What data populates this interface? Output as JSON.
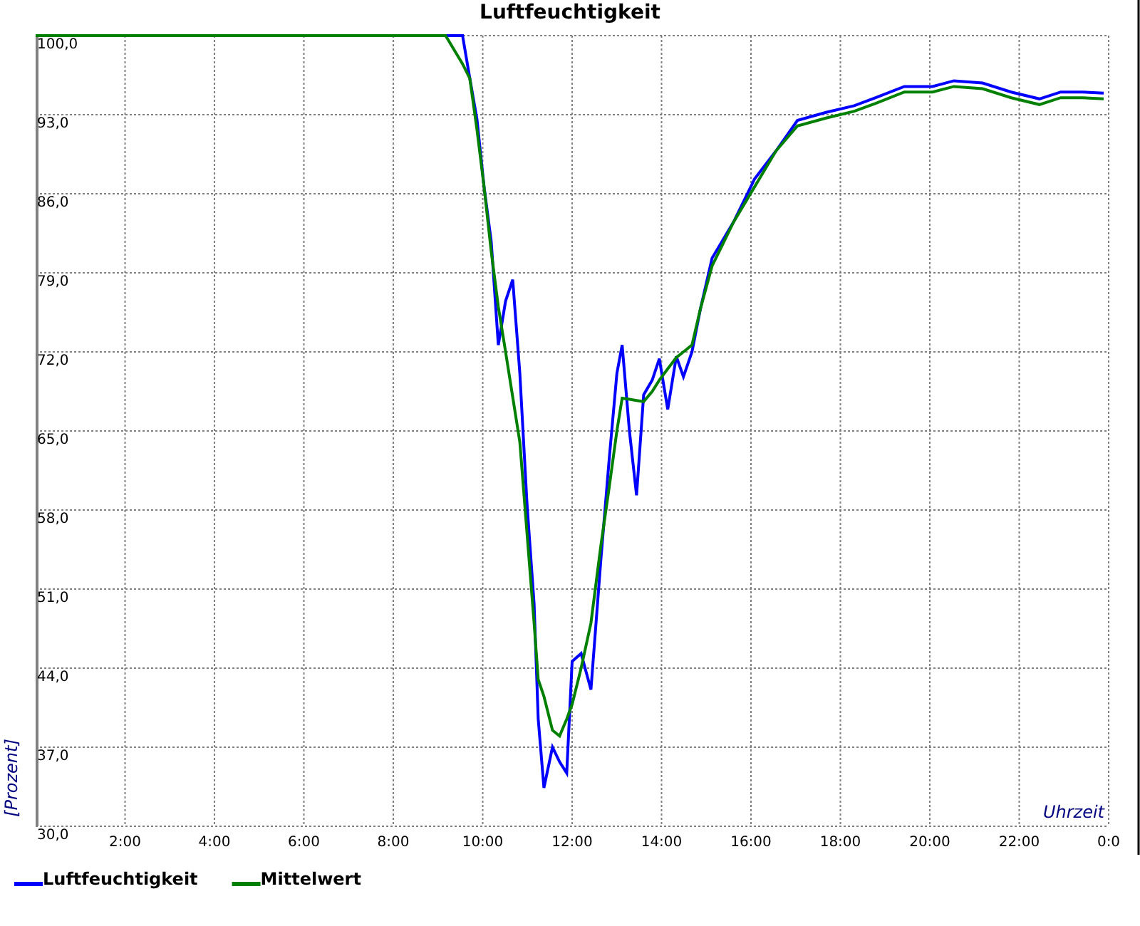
{
  "chart": {
    "chart_data": {
      "type": "line",
      "title": "Luftfeuchtigkeit",
      "xlabel": "Uhrzeit",
      "ylabel": "[Prozent]",
      "xlim": [
        0,
        24
      ],
      "ylim": [
        30,
        100
      ],
      "grid": true,
      "legend": true,
      "xticks": [
        {
          "value": 2,
          "label": "2:00"
        },
        {
          "value": 4,
          "label": "4:00"
        },
        {
          "value": 6,
          "label": "6:00"
        },
        {
          "value": 8,
          "label": "8:00"
        },
        {
          "value": 10,
          "label": "10:00"
        },
        {
          "value": 12,
          "label": "12:00"
        },
        {
          "value": 14,
          "label": "14:00"
        },
        {
          "value": 16,
          "label": "16:00"
        },
        {
          "value": 18,
          "label": "18:00"
        },
        {
          "value": 20,
          "label": "20:00"
        },
        {
          "value": 22,
          "label": "22:00"
        },
        {
          "value": 24,
          "label": "0:0"
        }
      ],
      "yticks": [
        {
          "value": 30,
          "label": "30,0"
        },
        {
          "value": 37,
          "label": "37,0"
        },
        {
          "value": 44,
          "label": "44,0"
        },
        {
          "value": 51,
          "label": "51,0"
        },
        {
          "value": 58,
          "label": "58,0"
        },
        {
          "value": 65,
          "label": "65,0"
        },
        {
          "value": 72,
          "label": "72,0"
        },
        {
          "value": 79,
          "label": "79,0"
        },
        {
          "value": 86,
          "label": "86,0"
        },
        {
          "value": 93,
          "label": "93,0"
        },
        {
          "value": 100,
          "label": "100,0"
        }
      ],
      "x": [
        0,
        9.17,
        9.55,
        9.71,
        9.87,
        10.03,
        10.19,
        10.35,
        10.51,
        10.67,
        10.83,
        10.99,
        11.15,
        11.24,
        11.37,
        11.56,
        11.72,
        11.88,
        12.0,
        12.2,
        12.42,
        12.64,
        12.83,
        13.0,
        13.12,
        13.28,
        13.44,
        13.6,
        13.79,
        13.95,
        14.14,
        14.33,
        14.49,
        14.68,
        14.87,
        15.13,
        15.61,
        16.08,
        16.56,
        17.04,
        17.68,
        18.31,
        18.79,
        19.43,
        20.06,
        20.54,
        21.18,
        21.82,
        22.45,
        22.93,
        23.41,
        23.89
      ],
      "series": [
        {
          "name": "Luftfeuchtigkeit",
          "color": "#0000ff",
          "values": [
            100,
            100,
            100,
            96.2,
            92.6,
            86.6,
            81.8,
            72.6,
            76.5,
            78.4,
            70.1,
            58.6,
            49.7,
            39.5,
            33.4,
            37.0,
            35.7,
            34.7,
            44.6,
            45.3,
            42.1,
            53.5,
            62.5,
            70.1,
            72.6,
            65.0,
            59.3,
            68.2,
            69.5,
            71.4,
            66.9,
            71.6,
            69.8,
            72.0,
            75.8,
            80.3,
            83.5,
            87.3,
            89.8,
            92.5,
            93.2,
            93.8,
            94.5,
            95.5,
            95.5,
            96.0,
            95.8,
            95.0,
            94.4,
            95.0,
            95.0,
            94.9
          ]
        },
        {
          "name": "Mittelwert",
          "color": "#008000",
          "values": [
            100,
            100,
            97.5,
            96.2,
            91.7,
            86.6,
            80.9,
            76.0,
            72.0,
            68.0,
            64.0,
            56.0,
            48.0,
            43.0,
            41.5,
            38.5,
            38.0,
            39.5,
            40.8,
            44.0,
            48.0,
            54.8,
            60.0,
            65.0,
            67.9,
            67.8,
            67.7,
            67.6,
            68.5,
            69.5,
            70.5,
            71.5,
            72.0,
            72.6,
            75.8,
            79.6,
            83.5,
            86.6,
            89.8,
            92.0,
            92.7,
            93.3,
            94.0,
            95.0,
            95.0,
            95.5,
            95.3,
            94.5,
            93.9,
            94.5,
            94.5,
            94.4
          ]
        }
      ]
    }
  }
}
